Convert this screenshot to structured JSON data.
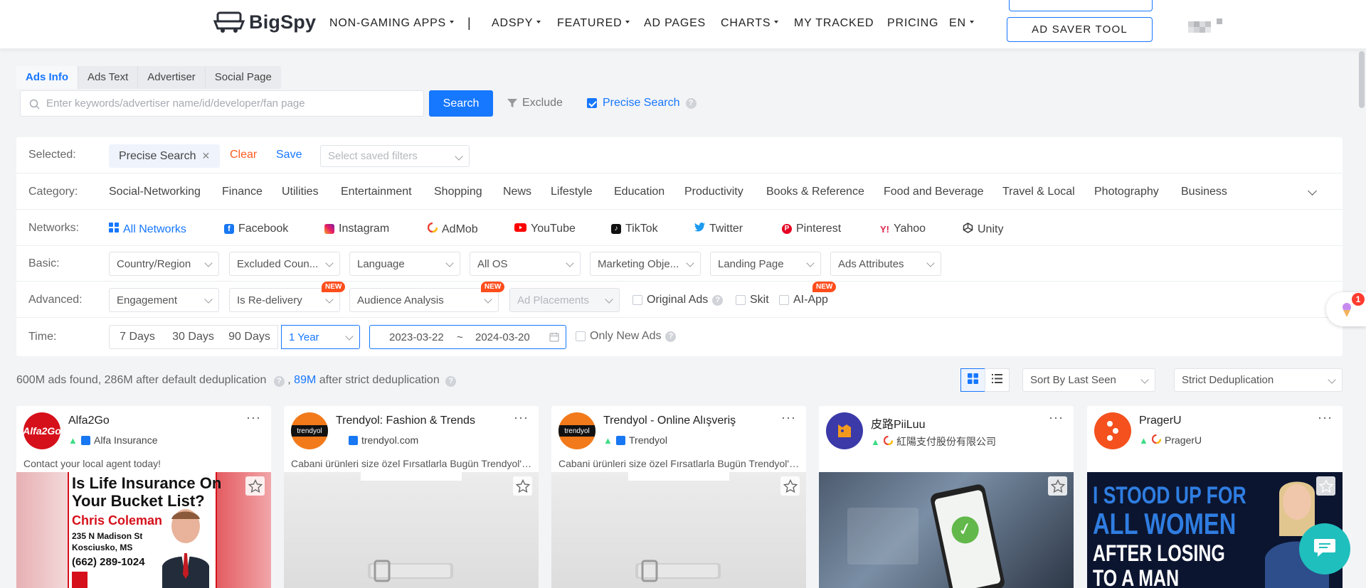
{
  "header": {
    "logo": "BigSpy",
    "nav": [
      "NON-GAMING APPS",
      "|",
      "ADSPY",
      "FEATURED",
      "AD PAGES",
      "CHARTS",
      "MY TRACKED",
      "PRICING",
      "EN"
    ],
    "ad_saver_label": "AD SAVER TOOL"
  },
  "search": {
    "tabs": [
      "Ads Info",
      "Ads Text",
      "Advertiser",
      "Social Page"
    ],
    "active_tab": "Ads Info",
    "placeholder": "Enter keywords/advertiser name/id/developer/fan page",
    "button": "Search",
    "exclude_label": "Exclude",
    "precise_label": "Precise Search",
    "precise_checked": true
  },
  "filters": {
    "selected": {
      "label": "Selected:",
      "chip": "Precise Search",
      "clear": "Clear",
      "save": "Save",
      "saved_placeholder": "Select saved filters"
    },
    "category": {
      "label": "Category:",
      "items": [
        "Social-Networking",
        "Finance",
        "Utilities",
        "Entertainment",
        "Shopping",
        "News",
        "Lifestyle",
        "Education",
        "Productivity",
        "Books & Reference",
        "Food and Beverage",
        "Travel & Local",
        "Photography",
        "Business"
      ]
    },
    "networks": {
      "label": "Networks:",
      "items": [
        "All Networks",
        "Facebook",
        "Instagram",
        "AdMob",
        "YouTube",
        "TikTok",
        "Twitter",
        "Pinterest",
        "Yahoo",
        "Unity"
      ]
    },
    "basic": {
      "label": "Basic:",
      "selects": [
        "Country/Region",
        "Excluded Coun...",
        "Language",
        "All OS",
        "Marketing Obje...",
        "Landing Page",
        "Ads Attributes"
      ]
    },
    "advanced": {
      "label": "Advanced:",
      "selects": [
        "Engagement",
        "Is Re-delivery",
        "Audience Analysis",
        "Ad Placements"
      ],
      "checks": [
        "Original Ads",
        "Skit",
        "AI-App"
      ],
      "new_badge": "NEW"
    },
    "time": {
      "label": "Time:",
      "buttons": [
        "7 Days",
        "30 Days",
        "90 Days"
      ],
      "active": "1 Year",
      "date_from": "2023-03-22",
      "date_sep": "~",
      "date_to": "2024-03-20",
      "only_new": "Only New Ads"
    }
  },
  "results": {
    "text_a": "600M ads found, 286M after default deduplication",
    "text_sep": ",",
    "highlight": "89M",
    "text_b": "after strict deduplication",
    "sort": "Sort By Last Seen",
    "dedup": "Strict Deduplication"
  },
  "cards": [
    {
      "title": "Alfa2Go",
      "sub": "Alfa Insurance",
      "desc": "Contact your local agent today!",
      "logo_text": "Alfa2Go",
      "ad": {
        "l1": "Is Life Insurance On",
        "l2": "Your Bucket List?",
        "name": "Chris Coleman",
        "addr1": "235 N Madison St",
        "addr2": "Kosciusko, MS",
        "phone": "(662) 289-1024"
      }
    },
    {
      "title": "Trendyol: Fashion & Trends",
      "sub": "trendyol.com",
      "desc": "Cabani ürünleri size özel Fırsatlarla Bugün Trendyol'da!",
      "logo_text": "trendyol"
    },
    {
      "title": "Trendyol - Online Alışveriş",
      "sub": "Trendyol",
      "desc": "Cabani ürünleri size özel Fırsatlarla Bugün Trendyol'da!",
      "logo_text": "trendyol"
    },
    {
      "title": "皮路PiiLuu",
      "sub": "紅陽支付股份有限公司",
      "desc": ""
    },
    {
      "title": "PragerU",
      "sub": "PragerU",
      "desc": "",
      "ad": {
        "l1": "I STOOD UP FOR",
        "l2": "ALL WOMEN",
        "l3": "AFTER LOSING",
        "l4": "TO A MAN"
      }
    }
  ],
  "floating": {
    "badge": "1"
  },
  "colors": {
    "accent": "#1677ff",
    "clear": "#ff5a1f",
    "new_badge": "#ff4d1c",
    "chat": "#1fbfbd"
  }
}
